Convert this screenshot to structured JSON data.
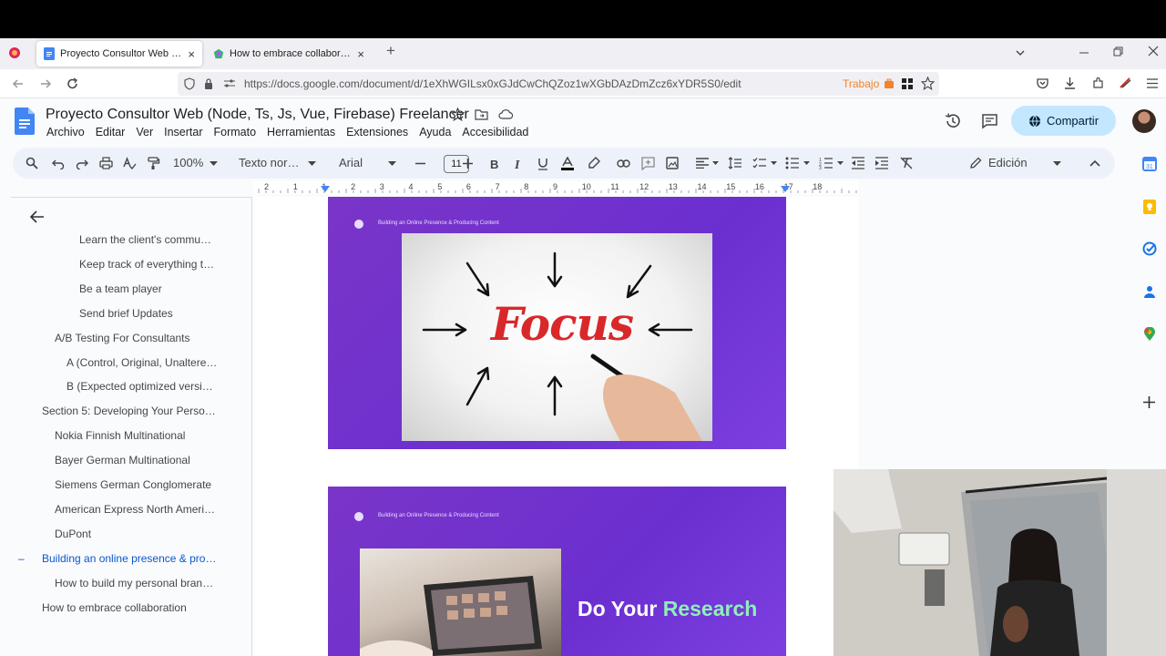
{
  "browser": {
    "tabs": [
      {
        "title": "Proyecto Consultor Web (Node",
        "active": true
      },
      {
        "title": "How to embrace collaboration",
        "active": false
      }
    ],
    "url": "https://docs.google.com/document/d/1eXhWGILsx0xGJdCwChQZoz1wXGbDAzDmZcz6xYDR5S0/edit",
    "container_label": "Trabajo",
    "new_tab": "+",
    "close_glyph": "×"
  },
  "doc": {
    "title": "Proyecto Consultor Web (Node, Ts, Js, Vue, Firebase) Freelancer",
    "menus": [
      "Archivo",
      "Editar",
      "Ver",
      "Insertar",
      "Formato",
      "Herramientas",
      "Extensiones",
      "Ayuda",
      "Accesibilidad"
    ],
    "share_label": "Compartir"
  },
  "toolbar": {
    "zoom": "100%",
    "style": "Texto nor…",
    "font": "Arial",
    "font_size": "11",
    "mode": "Edición"
  },
  "ruler": [
    "2",
    "1",
    "1",
    "2",
    "3",
    "4",
    "5",
    "6",
    "7",
    "8",
    "9",
    "10",
    "11",
    "12",
    "13",
    "14",
    "15",
    "16",
    "17",
    "18"
  ],
  "outline": [
    {
      "label": "Learn the client's commu…",
      "level": 3
    },
    {
      "label": "Keep track of everything t…",
      "level": 3
    },
    {
      "label": "Be a team player",
      "level": 3
    },
    {
      "label": "Send brief Updates",
      "level": 3
    },
    {
      "label": "A/B Testing For Consultants",
      "level": 2
    },
    {
      "label": "A (Control, Original, Unaltere…",
      "level": 2.5
    },
    {
      "label": "B (Expected optimized versi…",
      "level": 2.5
    },
    {
      "label": "Section 5: Developing Your Perso…",
      "level": 1
    },
    {
      "label": "Nokia Finnish Multinational",
      "level": 2
    },
    {
      "label": "Bayer German Multinational",
      "level": 2
    },
    {
      "label": "Siemens German Conglomerate",
      "level": 2
    },
    {
      "label": "American Express North Ameri…",
      "level": 2
    },
    {
      "label": "DuPont",
      "level": 2
    },
    {
      "label": "Building an online presence & pro…",
      "level": 1,
      "active": true
    },
    {
      "label": "How to build my personal bran…",
      "level": 2
    },
    {
      "label": "How to embrace collaboration",
      "level": 1
    }
  ],
  "slides": {
    "header": "Building an Online Presence & Producing Content",
    "focus_word": "Focus",
    "title_part1": "Do Your ",
    "title_part2": "Research"
  },
  "colors": {
    "accent": "#0b57d0",
    "share_bg": "#c2e7ff",
    "slide_purple": "#7031d0",
    "research_green": "#8ef0b8",
    "focus_red": "#d8282a"
  }
}
